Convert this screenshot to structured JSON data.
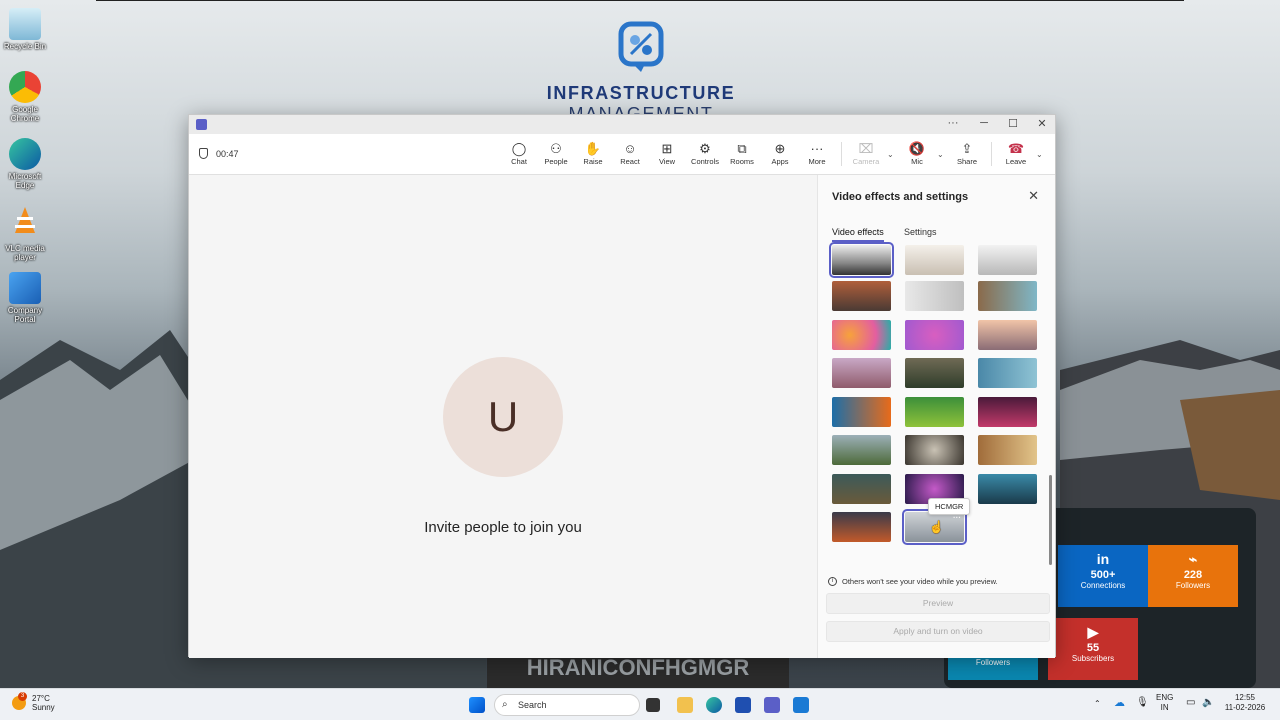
{
  "desktop": {
    "brand": {
      "word1": "INFRASTRUCTURE",
      "word2": "MANAGEMENT"
    },
    "icons": [
      {
        "label": "Recycle Bin",
        "icon": "recycle-bin-icon"
      },
      {
        "label": "Google Chrome",
        "icon": "chrome-icon"
      },
      {
        "label": "Microsoft Edge",
        "icon": "edge-icon"
      },
      {
        "label": "VLC media player",
        "icon": "vlc-icon"
      },
      {
        "label": "Company Portal",
        "icon": "company-portal-icon"
      }
    ],
    "social": [
      {
        "icon": "in",
        "value": "500+",
        "label": "Connections",
        "color": "#0a66c2"
      },
      {
        "icon": "rss",
        "value": "228",
        "label": "Followers",
        "color": "#e8730c"
      },
      {
        "icon": "",
        "value": "",
        "label": "Followers",
        "color": "#0a87b0"
      },
      {
        "icon": "yt",
        "value": "55",
        "label": "Subscribers",
        "color": "#c4302b"
      }
    ],
    "banner": "HIRANICONFHGMGR"
  },
  "teams": {
    "timer": "00:47",
    "toolbar": [
      {
        "label": "Chat",
        "icon": "chat-icon",
        "glyph": "💬"
      },
      {
        "label": "People",
        "icon": "people-icon",
        "glyph": "👤"
      },
      {
        "label": "Raise",
        "icon": "raise-hand-icon",
        "glyph": "✋"
      },
      {
        "label": "React",
        "icon": "react-icon",
        "glyph": "☺"
      },
      {
        "label": "View",
        "icon": "view-icon",
        "glyph": "⊞"
      },
      {
        "label": "Controls",
        "icon": "controls-icon",
        "glyph": "⚙"
      },
      {
        "label": "Rooms",
        "icon": "rooms-icon",
        "glyph": "⧉"
      },
      {
        "label": "Apps",
        "icon": "apps-icon",
        "glyph": "⊕"
      },
      {
        "label": "More",
        "icon": "more-icon",
        "glyph": "···"
      }
    ],
    "camera_label": "Camera",
    "mic_label": "Mic",
    "share_label": "Share",
    "leave_label": "Leave",
    "avatar_initial": "U",
    "invite_text": "Invite people to join you",
    "panel": {
      "title": "Video effects and settings",
      "tab_effects": "Video effects",
      "tab_settings": "Settings",
      "tooltip": "HCMGR",
      "notice": "Others won't see your video while you preview.",
      "preview_label": "Preview",
      "apply_label": "Apply and turn on video"
    }
  },
  "taskbar": {
    "temp": "27°C",
    "condition": "Sunny",
    "weather_badge": "3",
    "search_placeholder": "Search",
    "lang1": "ENG",
    "lang2": "IN",
    "time": "12:55",
    "date": "11-02-2026"
  },
  "colors": {
    "teams_accent": "#5b5fc7",
    "leave_red": "#c4314b",
    "brand_blue": "#1f3a78"
  }
}
